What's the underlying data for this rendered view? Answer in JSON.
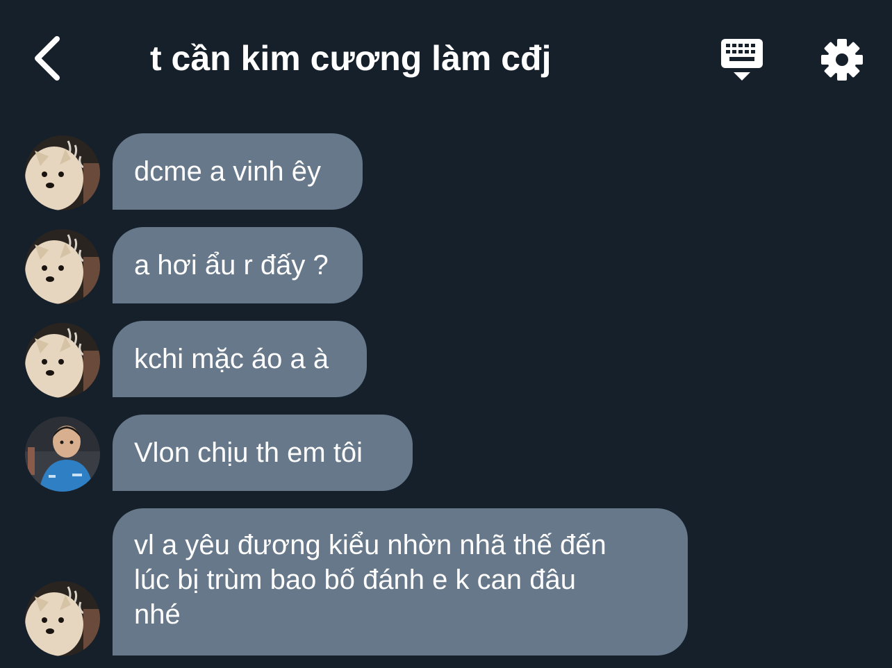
{
  "header": {
    "title": "t cần kim cương làm cđj",
    "back_icon": "chevron-left-icon",
    "keyboard_icon": "keyboard-icon",
    "settings_icon": "gear-icon"
  },
  "colors": {
    "background": "#15202b",
    "bubble": "#66788a",
    "text": "#ffffff"
  },
  "messages": [
    {
      "text": "dcme a vinh êy",
      "avatar": "dog"
    },
    {
      "text": "a hơi ẩu r đấy ?",
      "avatar": "dog"
    },
    {
      "text": "kchi mặc áo a à",
      "avatar": "dog"
    },
    {
      "text": "Vlon chịu th em tôi",
      "avatar": "boy"
    },
    {
      "text": "vl a yêu đương kiểu nhờn nhã thế đến\nlúc bị trùm bao bố đánh e k can đâu\nnhé",
      "avatar": "dog"
    }
  ]
}
